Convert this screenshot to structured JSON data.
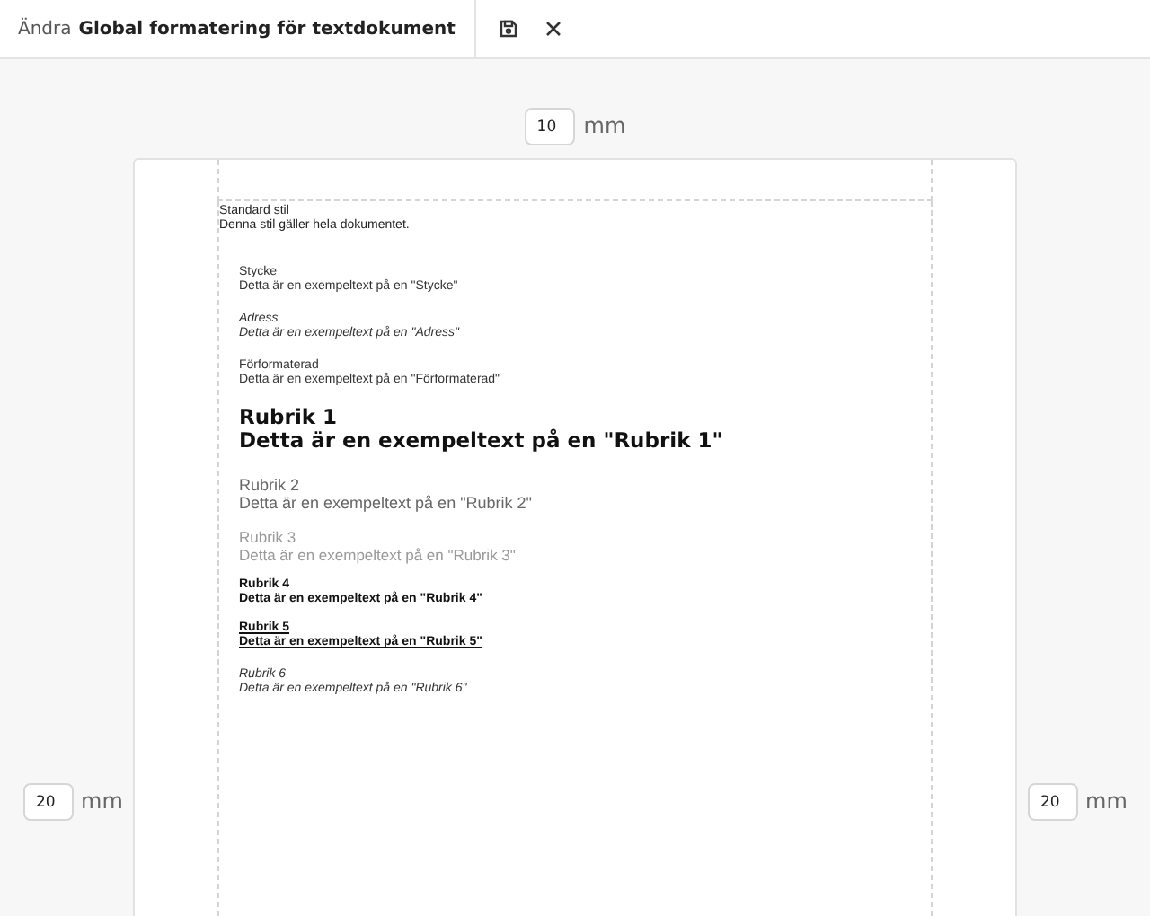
{
  "header": {
    "prefix": "Ändra",
    "title": "Global formatering för textdokument"
  },
  "margins": {
    "top": {
      "value": "10",
      "unit": "mm"
    },
    "left": {
      "value": "20",
      "unit": "mm"
    },
    "right": {
      "value": "20",
      "unit": "mm"
    }
  },
  "document": {
    "title": "Standard stil",
    "description": "Denna stil gäller hela dokumentet.",
    "styles": [
      {
        "kind": "paragraph",
        "name": "Stycke",
        "sample": "Detta är en exempeltext på en \"Stycke\""
      },
      {
        "kind": "address",
        "name": "Adress",
        "sample": "Detta är en exempeltext på en \"Adress\""
      },
      {
        "kind": "preformatted",
        "name": "Förformaterad",
        "sample": "Detta är en exempeltext på en \"Förformaterad\""
      },
      {
        "kind": "h1",
        "name": "Rubrik 1",
        "sample": "Detta är en exempeltext på en \"Rubrik 1\""
      },
      {
        "kind": "h2",
        "name": "Rubrik 2",
        "sample": "Detta är en exempeltext på en \"Rubrik 2\""
      },
      {
        "kind": "h3",
        "name": "Rubrik 3",
        "sample": "Detta är en exempeltext på en \"Rubrik 3\""
      },
      {
        "kind": "h4",
        "name": "Rubrik 4",
        "sample": "Detta är en exempeltext på en \"Rubrik 4\""
      },
      {
        "kind": "h5",
        "name": "Rubrik 5",
        "sample": "Detta är en exempeltext på en \"Rubrik 5\""
      },
      {
        "kind": "h6",
        "name": "Rubrik 6",
        "sample": "Detta är en exempeltext på en \"Rubrik 6\""
      }
    ]
  }
}
